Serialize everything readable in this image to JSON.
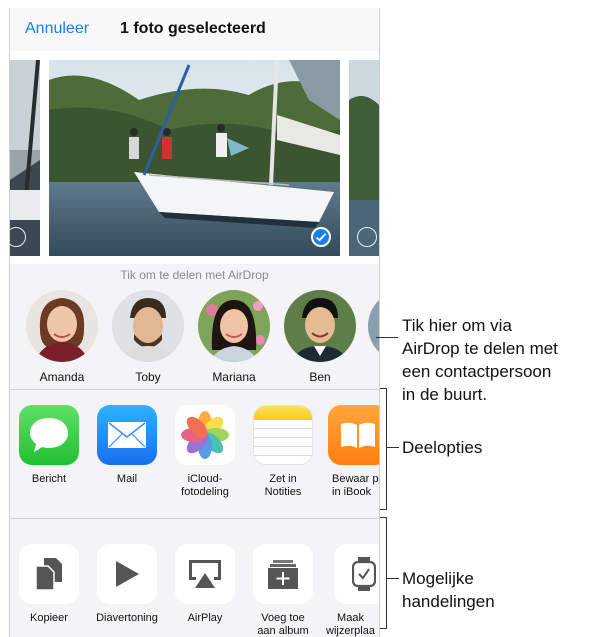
{
  "nav": {
    "cancel": "Annuleer",
    "title": "1 foto geselecteerd"
  },
  "airdrop": {
    "hint": "Tik om te delen met AirDrop",
    "contacts": [
      {
        "name": "Amanda"
      },
      {
        "name": "Toby"
      },
      {
        "name": "Mariana"
      },
      {
        "name": "Ben"
      }
    ]
  },
  "share_apps": [
    {
      "label": "Bericht",
      "icon": "messages-icon"
    },
    {
      "label": "Mail",
      "icon": "mail-icon"
    },
    {
      "label": "iCloud-\nfotodeling",
      "icon": "photos-icon"
    },
    {
      "label": "Zet in\nNotities",
      "icon": "notes-icon"
    },
    {
      "label": "Bewaar p\nin iBook",
      "icon": "ibooks-icon"
    }
  ],
  "actions": [
    {
      "label": "Kopieer",
      "icon": "copy-icon"
    },
    {
      "label": "Diavertoning",
      "icon": "play-icon"
    },
    {
      "label": "AirPlay",
      "icon": "airplay-icon"
    },
    {
      "label": "Voeg toe\naan album",
      "icon": "add-album-icon"
    },
    {
      "label": "Maak\nwijzerplaa",
      "icon": "watch-icon"
    }
  ],
  "callouts": {
    "airdrop": "Tik hier om via\nAirDrop te delen met\neen contactpersoon\nin de buurt.",
    "share": "Deelopties",
    "actions": "Mogelijke\nhandelingen"
  },
  "colors": {
    "accent": "#1a7cf2"
  }
}
